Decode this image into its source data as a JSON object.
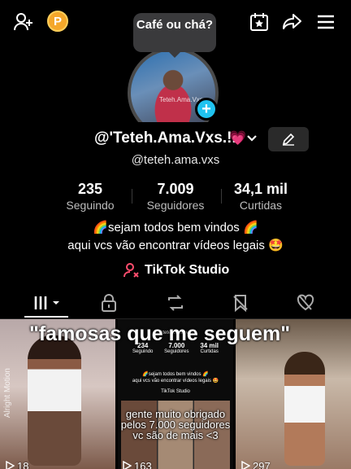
{
  "header": {
    "coin_letter": "P",
    "tooltip_text": "Café ou chá?"
  },
  "profile": {
    "avatar_caption": "Teteh.Ama.Vxs",
    "display_name": "@'Teteh.Ama.Vxs.!..",
    "heart": "💗",
    "handle": "@teteh.ama.vxs",
    "stats": [
      {
        "value": "235",
        "label": "Seguindo"
      },
      {
        "value": "7.009",
        "label": "Seguidores"
      },
      {
        "value": "34,1 mil",
        "label": "Curtidas"
      }
    ],
    "bio_line1": "🌈sejam todos bem vindos 🌈",
    "bio_line2": "aqui vcs vão encontrar vídeos legais 🤩",
    "studio_label": "TikTok Studio"
  },
  "tabs": [
    {
      "name": "videos-tab",
      "icon": "grid-icon",
      "active": true
    },
    {
      "name": "private-tab",
      "icon": "lock-icon"
    },
    {
      "name": "reposts-tab",
      "icon": "repost-icon"
    },
    {
      "name": "favorites-tab",
      "icon": "bookmark-icon"
    },
    {
      "name": "liked-tab",
      "icon": "heart-icon"
    }
  ],
  "grid": {
    "overlay_title": "\"famosas que me seguem\"",
    "cell1_watermark": "Alright Motion",
    "cell1_views": "18",
    "cell2": {
      "handle": "@teteh.ama.vxs",
      "stats": [
        {
          "value": "234",
          "label": "Seguindo"
        },
        {
          "value": "7.000",
          "label": "Seguidores"
        },
        {
          "value": "34 mil",
          "label": "Curtidas"
        }
      ],
      "bio_line1": "🌈sejam todos bem vindos 🌈",
      "bio_line2": "aqui vcs vão encontrar vídeos legais 🤩",
      "studio": "TikTok Studio",
      "caption": "gente muito obrigado pelos 7.000 seguidores vc são de mais <3",
      "views": "163"
    },
    "cell3_views": "297"
  }
}
